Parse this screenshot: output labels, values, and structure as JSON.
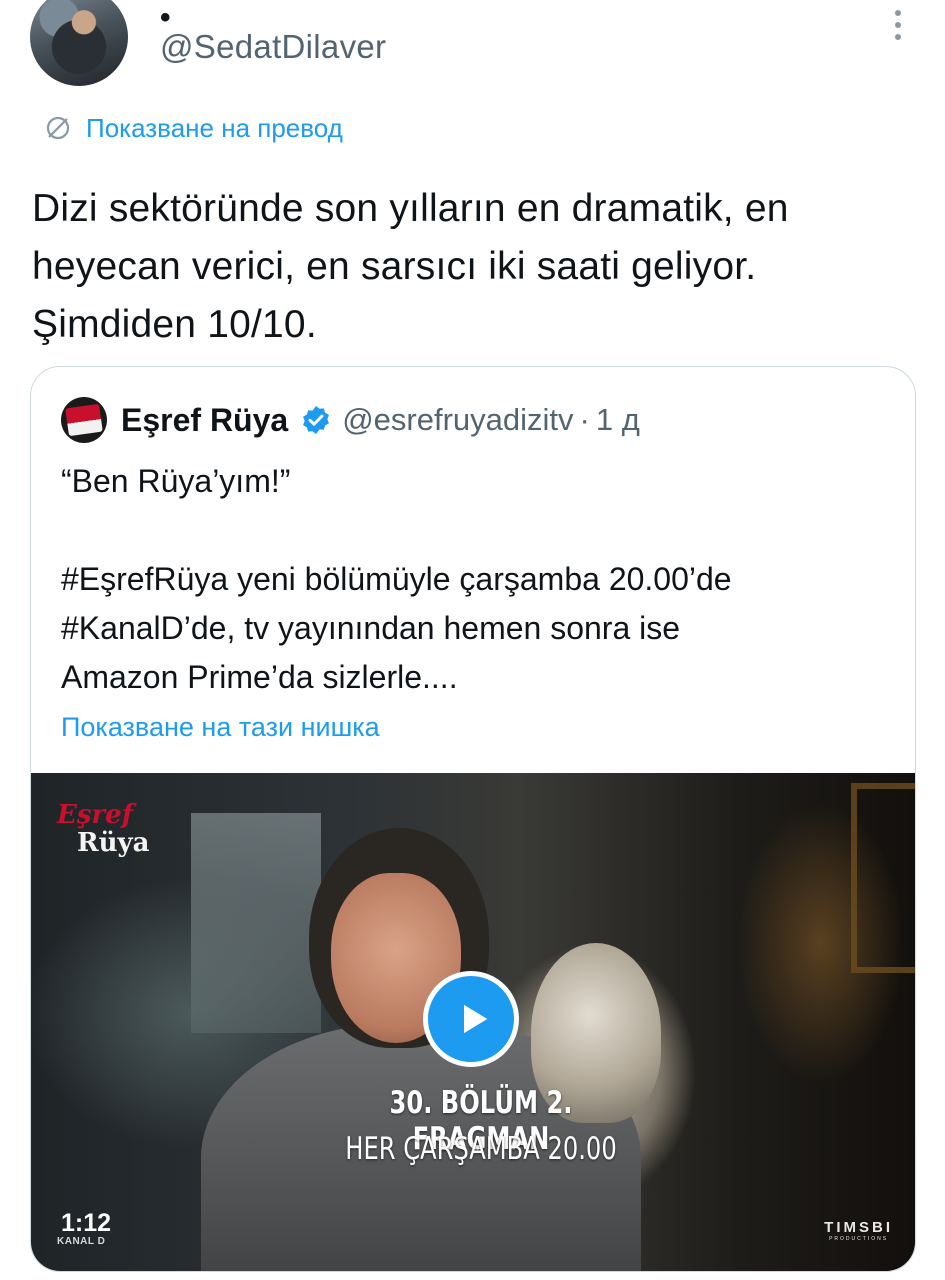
{
  "tweet": {
    "display_name": "•",
    "handle": "@SedatDilaver",
    "translate_label": "Показване на превод",
    "text_lines": [
      "Dizi sektöründe son yılların en dramatik, en",
      "heyecan verici, en sarsıcı iki saati geliyor.",
      "Şimdiden 10/10."
    ]
  },
  "quote": {
    "name": "Eşref Rüya",
    "handle": "@esrefruyadizitv",
    "separator": "·",
    "time": "1 д",
    "text_lines": [
      "“Ben Rüya’yım!”",
      "",
      "#EşrefRüya yeni bölümüyle çarşamba 20.00’de",
      "#KanalD’de, tv yayınından hemen sonra ise",
      "Amazon Prime’da sizlerle...."
    ],
    "show_thread_label": "Показване на тази нишка"
  },
  "media": {
    "brand_logo_line1": "Eşref",
    "brand_logo_line2": "Rüya",
    "caption_line1": "30. BÖLÜM 2. FRAGMAN",
    "caption_line2": "HER ÇARŞAMBA 20.00",
    "duration": "1:12",
    "channel_logo": "KANAL D",
    "producer_logo": "TIMSBI",
    "producer_sub": "PRODUCTIONS"
  },
  "colors": {
    "accent": "#1d9bf0",
    "text_primary": "#0f1419",
    "text_secondary": "#536471",
    "border": "#cfd9de"
  },
  "icons": {
    "more": "more-vertical-icon",
    "translate": "translate-globe-icon",
    "verified": "verified-badge-icon",
    "play": "play-icon"
  }
}
